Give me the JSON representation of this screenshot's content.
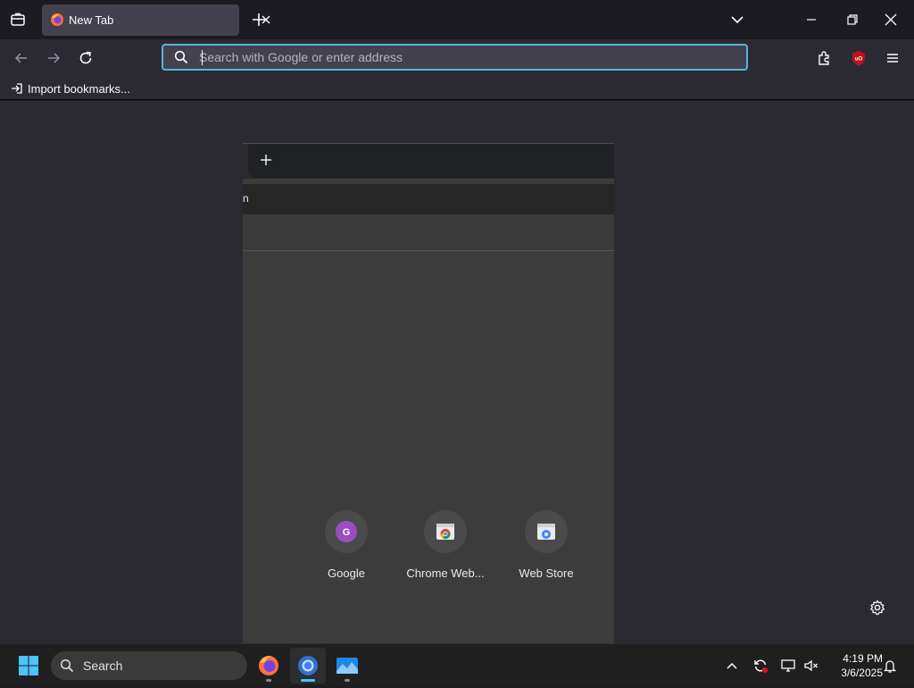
{
  "browser": {
    "tab": {
      "title": "New Tab"
    },
    "urlbar": {
      "placeholder": "Search with Google or enter address"
    },
    "bookmarks_toolbar": {
      "import_label": "Import bookmarks..."
    }
  },
  "embedded_page": {
    "toolbar_glyph": "n",
    "shortcuts": [
      {
        "label": "Google",
        "letter": "G"
      },
      {
        "label": "Chrome Web...",
        "letter": ""
      },
      {
        "label": "Web Store",
        "letter": ""
      }
    ]
  },
  "taskbar": {
    "search_label": "Search",
    "time": "4:19 PM",
    "date": "3/6/2025"
  },
  "colors": {
    "accent_focus": "#58b4d6",
    "ublock_red": "#c0111a",
    "firefox_orange": "#ff7139",
    "windows_blue": "#4cc2ff"
  }
}
